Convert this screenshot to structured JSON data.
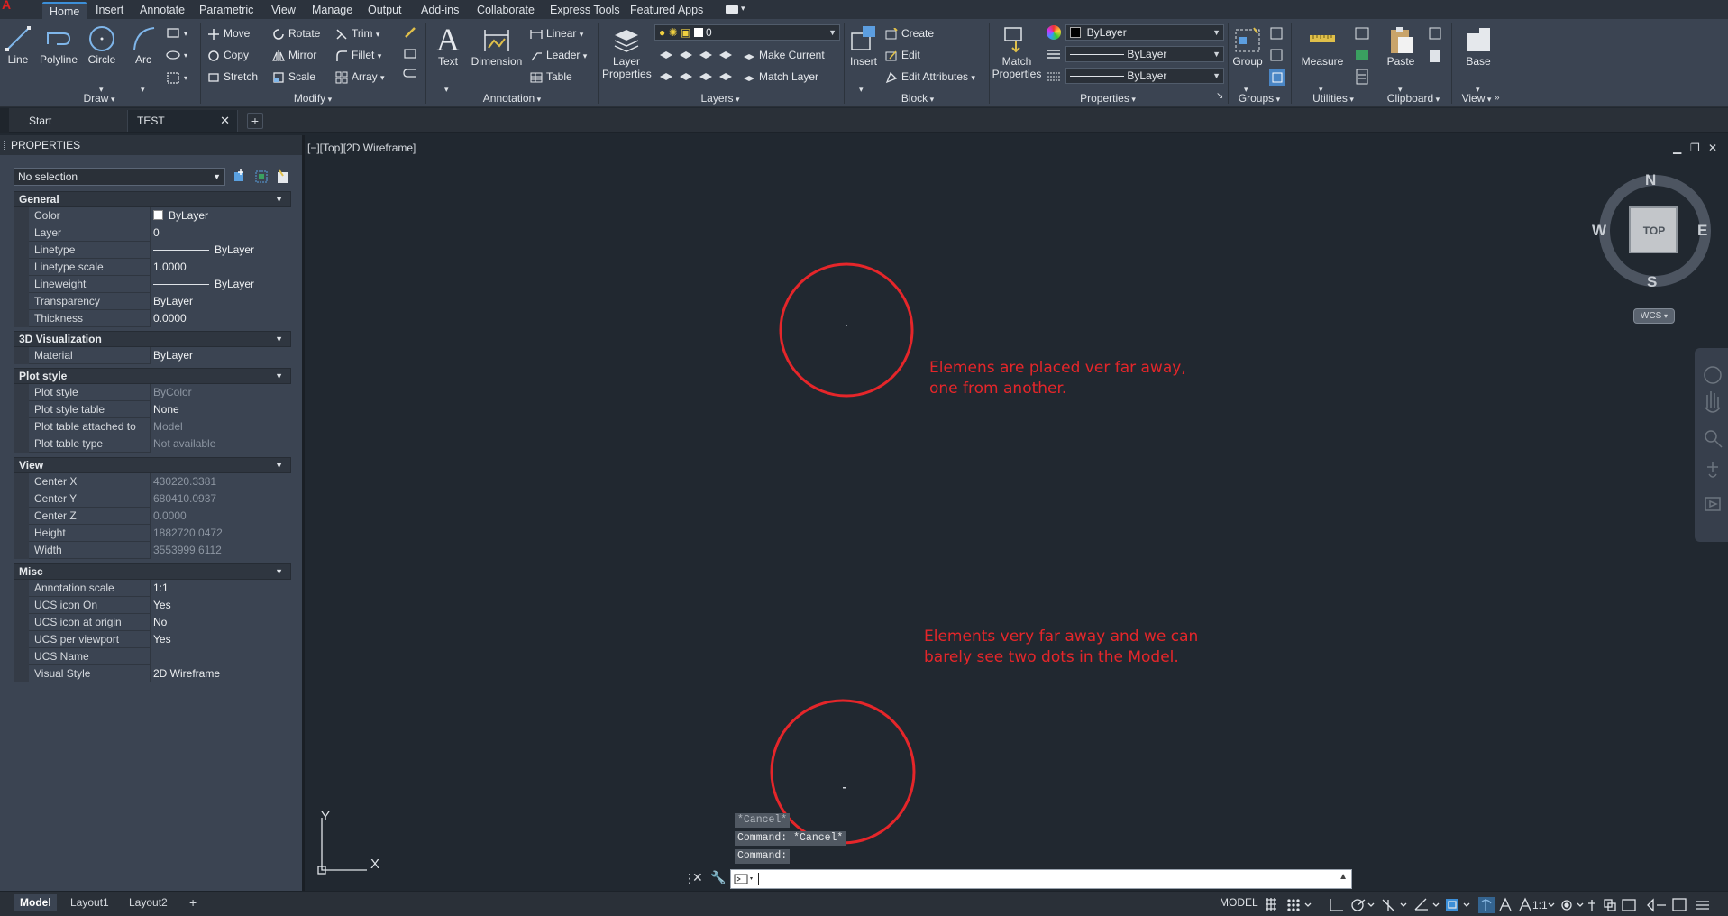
{
  "menu": {
    "tabs": [
      "Home",
      "Insert",
      "Annotate",
      "Parametric",
      "View",
      "Manage",
      "Output",
      "Add-ins",
      "Collaborate",
      "Express Tools",
      "Featured Apps"
    ],
    "active": "Home"
  },
  "ribbon": {
    "draw": {
      "title": "Draw",
      "line": "Line",
      "polyline": "Polyline",
      "circle": "Circle",
      "arc": "Arc"
    },
    "modify": {
      "title": "Modify",
      "move": "Move",
      "rotate": "Rotate",
      "trim": "Trim",
      "copy": "Copy",
      "mirror": "Mirror",
      "fillet": "Fillet",
      "stretch": "Stretch",
      "scale": "Scale",
      "array": "Array"
    },
    "annotation": {
      "title": "Annotation",
      "text": "Text",
      "dimension": "Dimension",
      "linear": "Linear",
      "leader": "Leader",
      "table": "Table"
    },
    "layers": {
      "title": "Layers",
      "layer_properties_1": "Layer",
      "layer_properties_2": "Properties",
      "current_layer": "0",
      "make_current": "Make Current",
      "match_layer": "Match Layer"
    },
    "block": {
      "title": "Block",
      "insert": "Insert",
      "create": "Create",
      "edit": "Edit",
      "edit_attributes": "Edit Attributes"
    },
    "properties": {
      "title": "Properties",
      "match_1": "Match",
      "match_2": "Properties",
      "color": "ByLayer",
      "linetype": "ByLayer",
      "lineweight": "ByLayer"
    },
    "groups": {
      "title": "Groups",
      "group": "Group"
    },
    "utilities": {
      "title": "Utilities",
      "measure": "Measure"
    },
    "clipboard": {
      "title": "Clipboard",
      "paste": "Paste"
    },
    "view": {
      "title": "View",
      "base": "Base"
    }
  },
  "doc_tabs": {
    "start": "Start",
    "test": "TEST"
  },
  "palette": {
    "title": "PROPERTIES",
    "selection": "No selection",
    "general": {
      "title": "General",
      "rows": [
        {
          "k": "Color",
          "v": "ByLayer"
        },
        {
          "k": "Layer",
          "v": "0"
        },
        {
          "k": "Linetype",
          "v": "ByLayer"
        },
        {
          "k": "Linetype scale",
          "v": "1.0000"
        },
        {
          "k": "Lineweight",
          "v": "ByLayer"
        },
        {
          "k": "Transparency",
          "v": "ByLayer"
        },
        {
          "k": "Thickness",
          "v": "0.0000"
        }
      ]
    },
    "viz": {
      "title": "3D Visualization",
      "rows": [
        {
          "k": "Material",
          "v": "ByLayer"
        }
      ]
    },
    "plot": {
      "title": "Plot style",
      "rows": [
        {
          "k": "Plot style",
          "v": "ByColor"
        },
        {
          "k": "Plot style table",
          "v": "None"
        },
        {
          "k": "Plot table attached to",
          "v": "Model"
        },
        {
          "k": "Plot table type",
          "v": "Not available"
        }
      ]
    },
    "view": {
      "title": "View",
      "rows": [
        {
          "k": "Center X",
          "v": "430220.3381"
        },
        {
          "k": "Center Y",
          "v": "680410.0937"
        },
        {
          "k": "Center Z",
          "v": "0.0000"
        },
        {
          "k": "Height",
          "v": "1882720.0472"
        },
        {
          "k": "Width",
          "v": "3553999.6112"
        }
      ]
    },
    "misc": {
      "title": "Misc",
      "rows": [
        {
          "k": "Annotation scale",
          "v": "1:1"
        },
        {
          "k": "UCS icon On",
          "v": "Yes"
        },
        {
          "k": "UCS icon at origin",
          "v": "No"
        },
        {
          "k": "UCS per viewport",
          "v": "Yes"
        },
        {
          "k": "UCS Name",
          "v": ""
        },
        {
          "k": "Visual Style",
          "v": "2D Wireframe"
        }
      ]
    }
  },
  "viewport": {
    "label": "[−][Top][2D Wireframe]",
    "annotation_1": [
      "Elemens are placed ver far away,",
      "one from another."
    ],
    "annotation_2": [
      "Elements very far away and we can",
      "barely see two dots in the Model."
    ],
    "ucs_x": "X",
    "ucs_y": "Y"
  },
  "viewcube": {
    "n": "N",
    "s": "S",
    "e": "E",
    "w": "W",
    "face": "TOP",
    "wcs": "WCS"
  },
  "command": {
    "history": [
      "*Cancel*",
      "Command: *Cancel*",
      "Command:"
    ]
  },
  "layouts": {
    "model": "Model",
    "layout1": "Layout1",
    "layout2": "Layout2"
  },
  "status": {
    "model": "MODEL",
    "scale": "1:1"
  },
  "colors": {
    "accent": "#3c8fd8",
    "annotation_red": "#e5262a",
    "canvas": "#212830"
  }
}
